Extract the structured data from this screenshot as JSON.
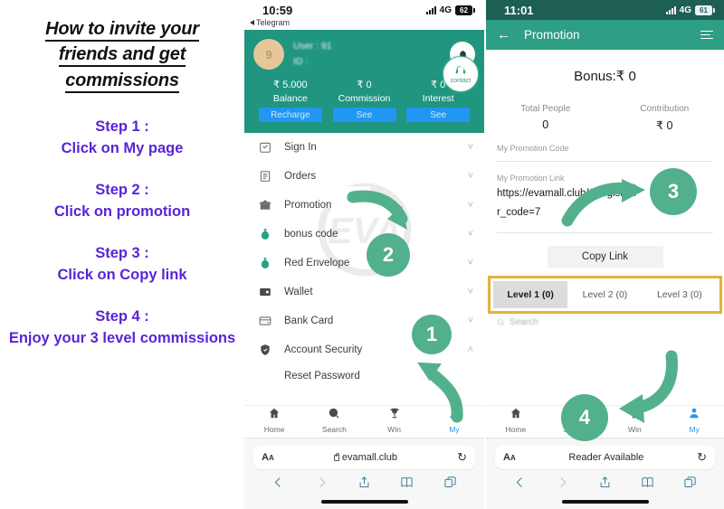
{
  "instructions": {
    "headline_lines": [
      "How to invite your ",
      "friends and get",
      "commissions"
    ],
    "steps": [
      {
        "title": "Step 1 :",
        "body": "Click on My page"
      },
      {
        "title": "Step 2 :",
        "body": "Click on promotion"
      },
      {
        "title": "Step 3 :",
        "body": "Click on Copy link"
      },
      {
        "title": "Step 4 :",
        "body": "Enjoy your 3 level commissions"
      }
    ],
    "accent_color": "#5a24d8",
    "headline_color": "#121212"
  },
  "phone_middle": {
    "status": {
      "time": "10:59",
      "back_app": "Telegram",
      "network": "4G",
      "battery": "62"
    },
    "account": {
      "avatar_initial": "9",
      "user_line": "User : 91",
      "id_line": "ID :",
      "bell_icon": "bell-icon",
      "stats": [
        {
          "value": "₹ 5.000",
          "label": "Balance",
          "button": "Recharge"
        },
        {
          "value": "₹ 0",
          "label": "Commission",
          "button": "See"
        },
        {
          "value": "₹ 0",
          "label": "Interest",
          "button": "See"
        }
      ]
    },
    "watermark": "EVA",
    "contact_button": {
      "label": "contact",
      "icon": "headset-icon"
    },
    "menu": [
      {
        "label": "Sign In",
        "icon": "calendar-check-icon",
        "chevron": "down"
      },
      {
        "label": "Orders",
        "icon": "list-icon",
        "chevron": "down"
      },
      {
        "label": "Promotion",
        "icon": "gift-box-icon",
        "chevron": "down"
      },
      {
        "label": "bonus code",
        "icon": "money-bag-icon",
        "chevron": "down"
      },
      {
        "label": "Red Envelope",
        "icon": "money-bag-icon",
        "chevron": "down"
      },
      {
        "label": "Wallet",
        "icon": "wallet-icon",
        "chevron": "down"
      },
      {
        "label": "Bank Card",
        "icon": "bank-card-icon",
        "chevron": "down"
      },
      {
        "label": "Account Security",
        "icon": "shield-icon",
        "chevron": "up"
      }
    ],
    "submenu": [
      {
        "label": "Reset Password"
      }
    ],
    "tabs": [
      {
        "label": "Home",
        "icon": "home-icon",
        "active": false
      },
      {
        "label": "Search",
        "icon": "search-icon",
        "active": false
      },
      {
        "label": "Win",
        "icon": "trophy-icon",
        "active": false
      },
      {
        "label": "My",
        "icon": "person-icon",
        "active": true
      }
    ],
    "safari": {
      "text_size_label": "AA",
      "address": "evamall.club",
      "secure_icon": "lock-icon",
      "reload_icon": "reload-icon",
      "tools": [
        "back-icon",
        "forward-icon",
        "share-icon",
        "bookmarks-icon",
        "tabs-icon"
      ]
    }
  },
  "phone_right": {
    "status": {
      "time": "11:01",
      "network": "4G",
      "battery": "61"
    },
    "header": {
      "back_icon": "back-arrow-icon",
      "title": "Promotion",
      "menu_icon": "hamburger-icon"
    },
    "bonus": "Bonus:₹ 0",
    "totals": [
      {
        "label": "Total People",
        "value": "0"
      },
      {
        "label": "Contribution",
        "value": "₹ 0"
      }
    ],
    "promotion_code": {
      "label": "My Promotion Code",
      "value": ""
    },
    "promotion_link": {
      "label": "My Promotion Link",
      "value": "https://evamall.club/#/register?",
      "value2": "r_code=7"
    },
    "copy_button": "Copy Link",
    "levels": [
      {
        "label": "Level 1",
        "count": "(0)",
        "active": true
      },
      {
        "label": "Level 2",
        "count": "(0)",
        "active": false
      },
      {
        "label": "Level 3",
        "count": "(0)",
        "active": false
      }
    ],
    "search_placeholder": "Search",
    "highlight_color": "#e3b33a",
    "tabs": [
      {
        "label": "Home",
        "icon": "home-icon",
        "active": false
      },
      {
        "label": "Search",
        "icon": "search-icon",
        "active": false
      },
      {
        "label": "Win",
        "icon": "trophy-icon",
        "active": false
      },
      {
        "label": "My",
        "icon": "person-icon",
        "active": true
      }
    ],
    "safari": {
      "text_size_label": "AA",
      "address": "Reader Available",
      "reload_icon": "reload-icon"
    }
  },
  "annotations": {
    "color": "#53b08c",
    "markers": [
      {
        "number": "1"
      },
      {
        "number": "2"
      },
      {
        "number": "3"
      },
      {
        "number": "4"
      }
    ]
  }
}
